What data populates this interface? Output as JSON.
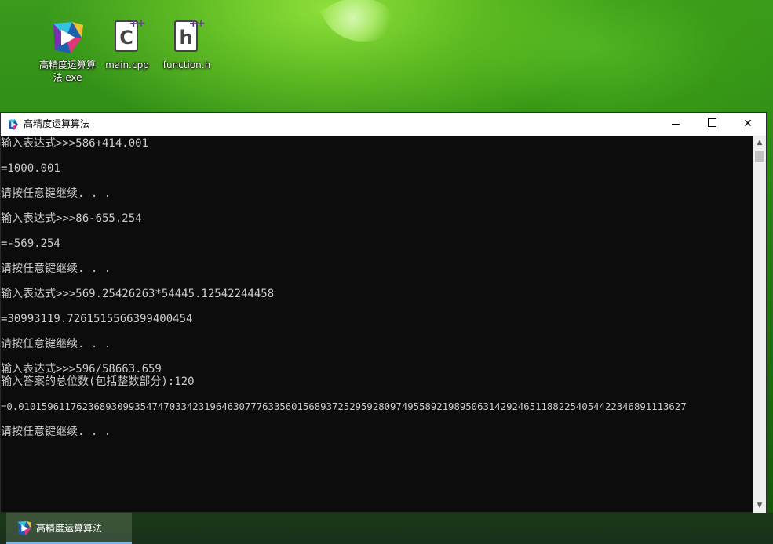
{
  "desktop": {
    "icons": [
      {
        "label": "高精度运算算法.exe",
        "icon": "app-exe-icon"
      },
      {
        "label": "main.cpp",
        "icon": "cpp-file-icon",
        "glyph": "C"
      },
      {
        "label": "function.h",
        "icon": "header-file-icon",
        "glyph": "h"
      }
    ],
    "plus_glyph": "++"
  },
  "window": {
    "title": "高精度运算算法",
    "controls": {
      "minimize": "minimize",
      "maximize": "maximize",
      "close": "✕"
    },
    "console_lines": [
      "输入表达式>>>586+414.001",
      "=1000.001",
      "请按任意键继续. . .",
      "输入表达式>>>86-655.254",
      "=-569.254",
      "请按任意键继续. . .",
      "输入表达式>>>569.25426263*54445.12542244458",
      "=30993119.7261515566399400454",
      "请按任意键继续. . .",
      "输入表达式>>>596/58663.659",
      "输入答案的总位数(包括整数部分):120",
      "=0.0101596117623689309935474703342319646307776335601568937252959280974955892198950631429246511882254054422346891113627",
      "请按任意键继续. . ."
    ],
    "scroll": {
      "up": "▲",
      "down": "▼"
    }
  },
  "taskbar": {
    "items": [
      {
        "label": "高精度运算算法",
        "active": true
      }
    ]
  },
  "colors": {
    "console_bg": "#0c0c0c",
    "console_text": "#cccccc",
    "taskbar_accent": "#76b9ed"
  }
}
